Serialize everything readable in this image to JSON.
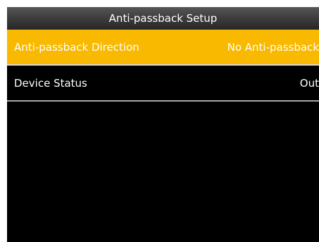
{
  "header": {
    "title": "Anti-passback Setup"
  },
  "menu": {
    "items": [
      {
        "label": "Anti-passback Direction",
        "value": "No Anti-passback",
        "selected": true
      },
      {
        "label": "Device Status",
        "value": "Out",
        "selected": false
      }
    ]
  },
  "colors": {
    "selection": "#f9b900",
    "background": "#000000",
    "text": "#ffffff"
  }
}
